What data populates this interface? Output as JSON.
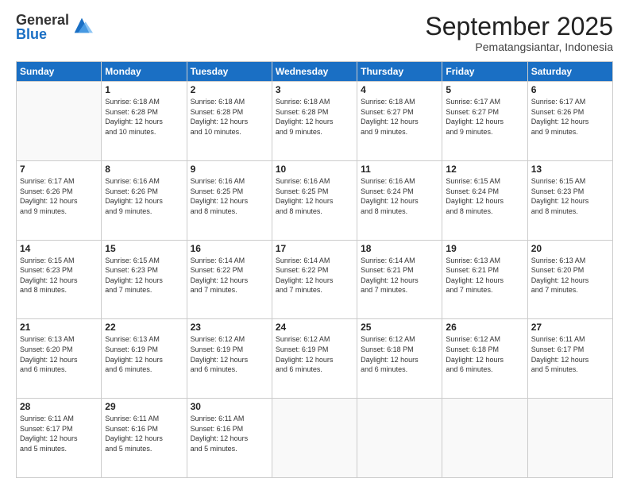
{
  "logo": {
    "general": "General",
    "blue": "Blue"
  },
  "header": {
    "month": "September 2025",
    "location": "Pematangsiantar, Indonesia"
  },
  "weekdays": [
    "Sunday",
    "Monday",
    "Tuesday",
    "Wednesday",
    "Thursday",
    "Friday",
    "Saturday"
  ],
  "weeks": [
    [
      {
        "day": "",
        "info": ""
      },
      {
        "day": "1",
        "info": "Sunrise: 6:18 AM\nSunset: 6:28 PM\nDaylight: 12 hours\nand 10 minutes."
      },
      {
        "day": "2",
        "info": "Sunrise: 6:18 AM\nSunset: 6:28 PM\nDaylight: 12 hours\nand 10 minutes."
      },
      {
        "day": "3",
        "info": "Sunrise: 6:18 AM\nSunset: 6:28 PM\nDaylight: 12 hours\nand 9 minutes."
      },
      {
        "day": "4",
        "info": "Sunrise: 6:18 AM\nSunset: 6:27 PM\nDaylight: 12 hours\nand 9 minutes."
      },
      {
        "day": "5",
        "info": "Sunrise: 6:17 AM\nSunset: 6:27 PM\nDaylight: 12 hours\nand 9 minutes."
      },
      {
        "day": "6",
        "info": "Sunrise: 6:17 AM\nSunset: 6:26 PM\nDaylight: 12 hours\nand 9 minutes."
      }
    ],
    [
      {
        "day": "7",
        "info": "Sunrise: 6:17 AM\nSunset: 6:26 PM\nDaylight: 12 hours\nand 9 minutes."
      },
      {
        "day": "8",
        "info": "Sunrise: 6:16 AM\nSunset: 6:26 PM\nDaylight: 12 hours\nand 9 minutes."
      },
      {
        "day": "9",
        "info": "Sunrise: 6:16 AM\nSunset: 6:25 PM\nDaylight: 12 hours\nand 8 minutes."
      },
      {
        "day": "10",
        "info": "Sunrise: 6:16 AM\nSunset: 6:25 PM\nDaylight: 12 hours\nand 8 minutes."
      },
      {
        "day": "11",
        "info": "Sunrise: 6:16 AM\nSunset: 6:24 PM\nDaylight: 12 hours\nand 8 minutes."
      },
      {
        "day": "12",
        "info": "Sunrise: 6:15 AM\nSunset: 6:24 PM\nDaylight: 12 hours\nand 8 minutes."
      },
      {
        "day": "13",
        "info": "Sunrise: 6:15 AM\nSunset: 6:23 PM\nDaylight: 12 hours\nand 8 minutes."
      }
    ],
    [
      {
        "day": "14",
        "info": "Sunrise: 6:15 AM\nSunset: 6:23 PM\nDaylight: 12 hours\nand 8 minutes."
      },
      {
        "day": "15",
        "info": "Sunrise: 6:15 AM\nSunset: 6:23 PM\nDaylight: 12 hours\nand 7 minutes."
      },
      {
        "day": "16",
        "info": "Sunrise: 6:14 AM\nSunset: 6:22 PM\nDaylight: 12 hours\nand 7 minutes."
      },
      {
        "day": "17",
        "info": "Sunrise: 6:14 AM\nSunset: 6:22 PM\nDaylight: 12 hours\nand 7 minutes."
      },
      {
        "day": "18",
        "info": "Sunrise: 6:14 AM\nSunset: 6:21 PM\nDaylight: 12 hours\nand 7 minutes."
      },
      {
        "day": "19",
        "info": "Sunrise: 6:13 AM\nSunset: 6:21 PM\nDaylight: 12 hours\nand 7 minutes."
      },
      {
        "day": "20",
        "info": "Sunrise: 6:13 AM\nSunset: 6:20 PM\nDaylight: 12 hours\nand 7 minutes."
      }
    ],
    [
      {
        "day": "21",
        "info": "Sunrise: 6:13 AM\nSunset: 6:20 PM\nDaylight: 12 hours\nand 6 minutes."
      },
      {
        "day": "22",
        "info": "Sunrise: 6:13 AM\nSunset: 6:19 PM\nDaylight: 12 hours\nand 6 minutes."
      },
      {
        "day": "23",
        "info": "Sunrise: 6:12 AM\nSunset: 6:19 PM\nDaylight: 12 hours\nand 6 minutes."
      },
      {
        "day": "24",
        "info": "Sunrise: 6:12 AM\nSunset: 6:19 PM\nDaylight: 12 hours\nand 6 minutes."
      },
      {
        "day": "25",
        "info": "Sunrise: 6:12 AM\nSunset: 6:18 PM\nDaylight: 12 hours\nand 6 minutes."
      },
      {
        "day": "26",
        "info": "Sunrise: 6:12 AM\nSunset: 6:18 PM\nDaylight: 12 hours\nand 6 minutes."
      },
      {
        "day": "27",
        "info": "Sunrise: 6:11 AM\nSunset: 6:17 PM\nDaylight: 12 hours\nand 5 minutes."
      }
    ],
    [
      {
        "day": "28",
        "info": "Sunrise: 6:11 AM\nSunset: 6:17 PM\nDaylight: 12 hours\nand 5 minutes."
      },
      {
        "day": "29",
        "info": "Sunrise: 6:11 AM\nSunset: 6:16 PM\nDaylight: 12 hours\nand 5 minutes."
      },
      {
        "day": "30",
        "info": "Sunrise: 6:11 AM\nSunset: 6:16 PM\nDaylight: 12 hours\nand 5 minutes."
      },
      {
        "day": "",
        "info": ""
      },
      {
        "day": "",
        "info": ""
      },
      {
        "day": "",
        "info": ""
      },
      {
        "day": "",
        "info": ""
      }
    ]
  ]
}
